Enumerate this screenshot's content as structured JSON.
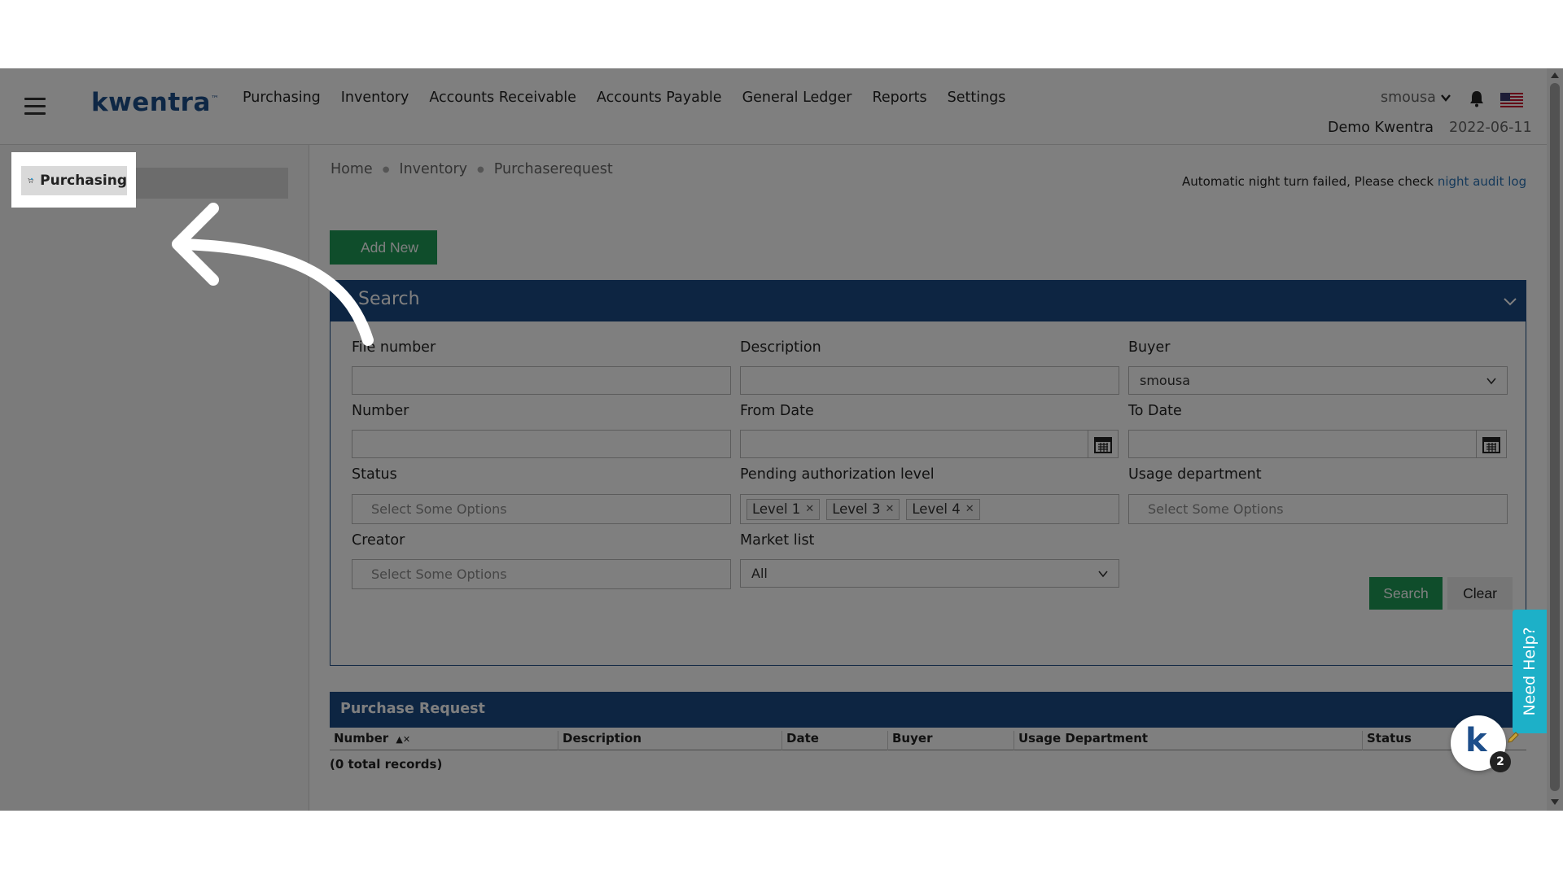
{
  "header": {
    "logo": "kwentra",
    "logo_tm": "™",
    "nav": [
      "Purchasing",
      "Inventory",
      "Accounts Receivable",
      "Accounts Payable",
      "General Ledger",
      "Reports",
      "Settings"
    ],
    "username": "smousa",
    "company": "Demo Kwentra",
    "date": "2022-06-11"
  },
  "sidebar": {
    "highlighted_item": "Purchasing"
  },
  "breadcrumb": [
    "Home",
    "Inventory",
    "Purchaserequest"
  ],
  "alert": {
    "message": "Automatic night turn failed, Please check",
    "link": "night audit log"
  },
  "add_new_label": "Add New",
  "search_panel": {
    "title": "Search",
    "fields": {
      "file_number": {
        "label": "File number",
        "value": ""
      },
      "description": {
        "label": "Description",
        "value": ""
      },
      "buyer": {
        "label": "Buyer",
        "value": "smousa"
      },
      "number": {
        "label": "Number",
        "value": ""
      },
      "from_date": {
        "label": "From Date",
        "value": ""
      },
      "to_date": {
        "label": "To Date",
        "value": ""
      },
      "status": {
        "label": "Status",
        "placeholder": "Select Some Options"
      },
      "pending_level": {
        "label": "Pending authorization level",
        "chips": [
          "Level 1",
          "Level 3",
          "Level 4"
        ]
      },
      "usage_department": {
        "label": "Usage department",
        "placeholder": "Select Some Options"
      },
      "creator": {
        "label": "Creator",
        "placeholder": "Select Some Options"
      },
      "market_list": {
        "label": "Market list",
        "value": "All"
      }
    },
    "search_button": "Search",
    "clear_button": "Clear"
  },
  "purchase_request": {
    "title": "Purchase Request",
    "columns": [
      "Number",
      "Description",
      "Date",
      "Buyer",
      "Usage Department",
      "Status"
    ],
    "total_records": "(0 total records)"
  },
  "help": {
    "need_help": "Need Help?",
    "bot_badge": "2",
    "bot_letter": "k"
  },
  "colors": {
    "brand_blue": "#1b4a85",
    "green": "#1f9b57",
    "help_teal": "#1db0c8",
    "link": "#2a72b5"
  },
  "icons": [
    "hamburger-icon",
    "chevron-down-icon",
    "bell-icon",
    "us-flag-icon",
    "search-icon",
    "calendar-icon",
    "cart-icon",
    "close-icon",
    "sort-asc-icon",
    "pencil-icon"
  ]
}
